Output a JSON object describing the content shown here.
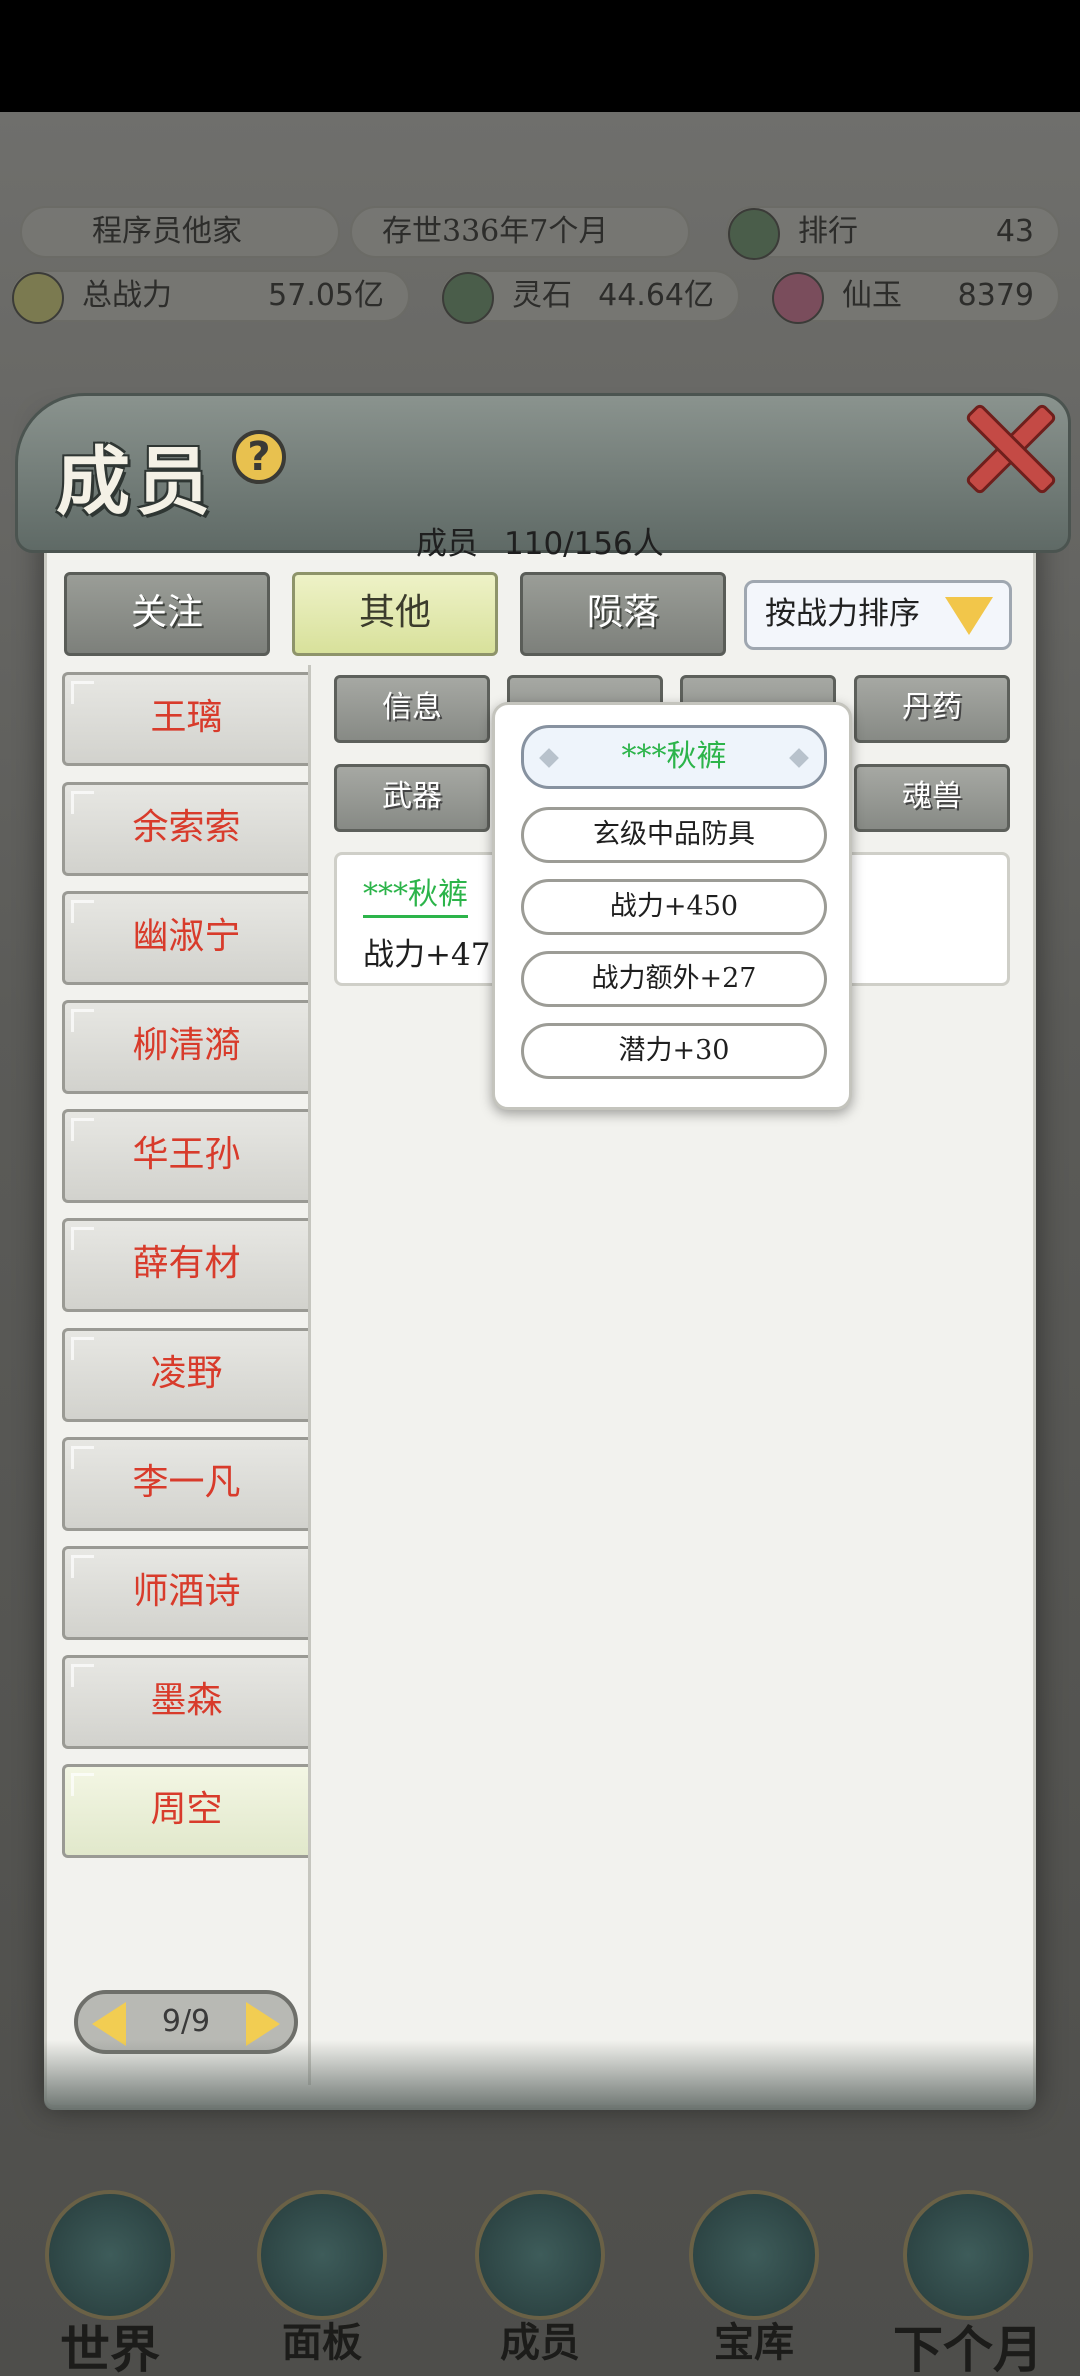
{
  "hud": {
    "player_name": "程序员他家",
    "age": "存世336年7个月",
    "rank_label": "排行",
    "rank_value": "43",
    "power_label": "总战力",
    "power_value": "57.05亿",
    "stone_label": "灵石",
    "stone_value": "44.64亿",
    "jade_label": "仙玉",
    "jade_value": "8379"
  },
  "modal": {
    "title": "成员",
    "help": "?",
    "count_label": "成员",
    "count_value": "110/156人"
  },
  "tabs": [
    {
      "label": "关注"
    },
    {
      "label": "其他"
    },
    {
      "label": "陨落"
    }
  ],
  "sort": {
    "label": "按战力排序"
  },
  "members": [
    {
      "name": "王璃"
    },
    {
      "name": "余索索"
    },
    {
      "name": "幽淑宁"
    },
    {
      "name": "柳清漪"
    },
    {
      "name": "华王孙"
    },
    {
      "name": "薛有材"
    },
    {
      "name": "凌野"
    },
    {
      "name": "李一凡"
    },
    {
      "name": "师酒诗"
    },
    {
      "name": "墨森"
    },
    {
      "name": "周空"
    }
  ],
  "subtabs": [
    {
      "label": "信息"
    },
    {
      "label": "丹药"
    },
    {
      "label": "武器"
    },
    {
      "label": "魂兽"
    }
  ],
  "info_card": {
    "item_name": "***秋裤",
    "stat": "战力+477"
  },
  "popup": {
    "title": "***秋裤",
    "lines": [
      "玄级中品防具",
      "战力+450",
      "战力额外+27",
      "潜力+30"
    ]
  },
  "pager": {
    "text": "9/9"
  },
  "bottom_nav": [
    {
      "label": "世界"
    },
    {
      "label": "面板"
    },
    {
      "label": "成员"
    },
    {
      "label": "宝库"
    },
    {
      "label": "下个月"
    }
  ]
}
